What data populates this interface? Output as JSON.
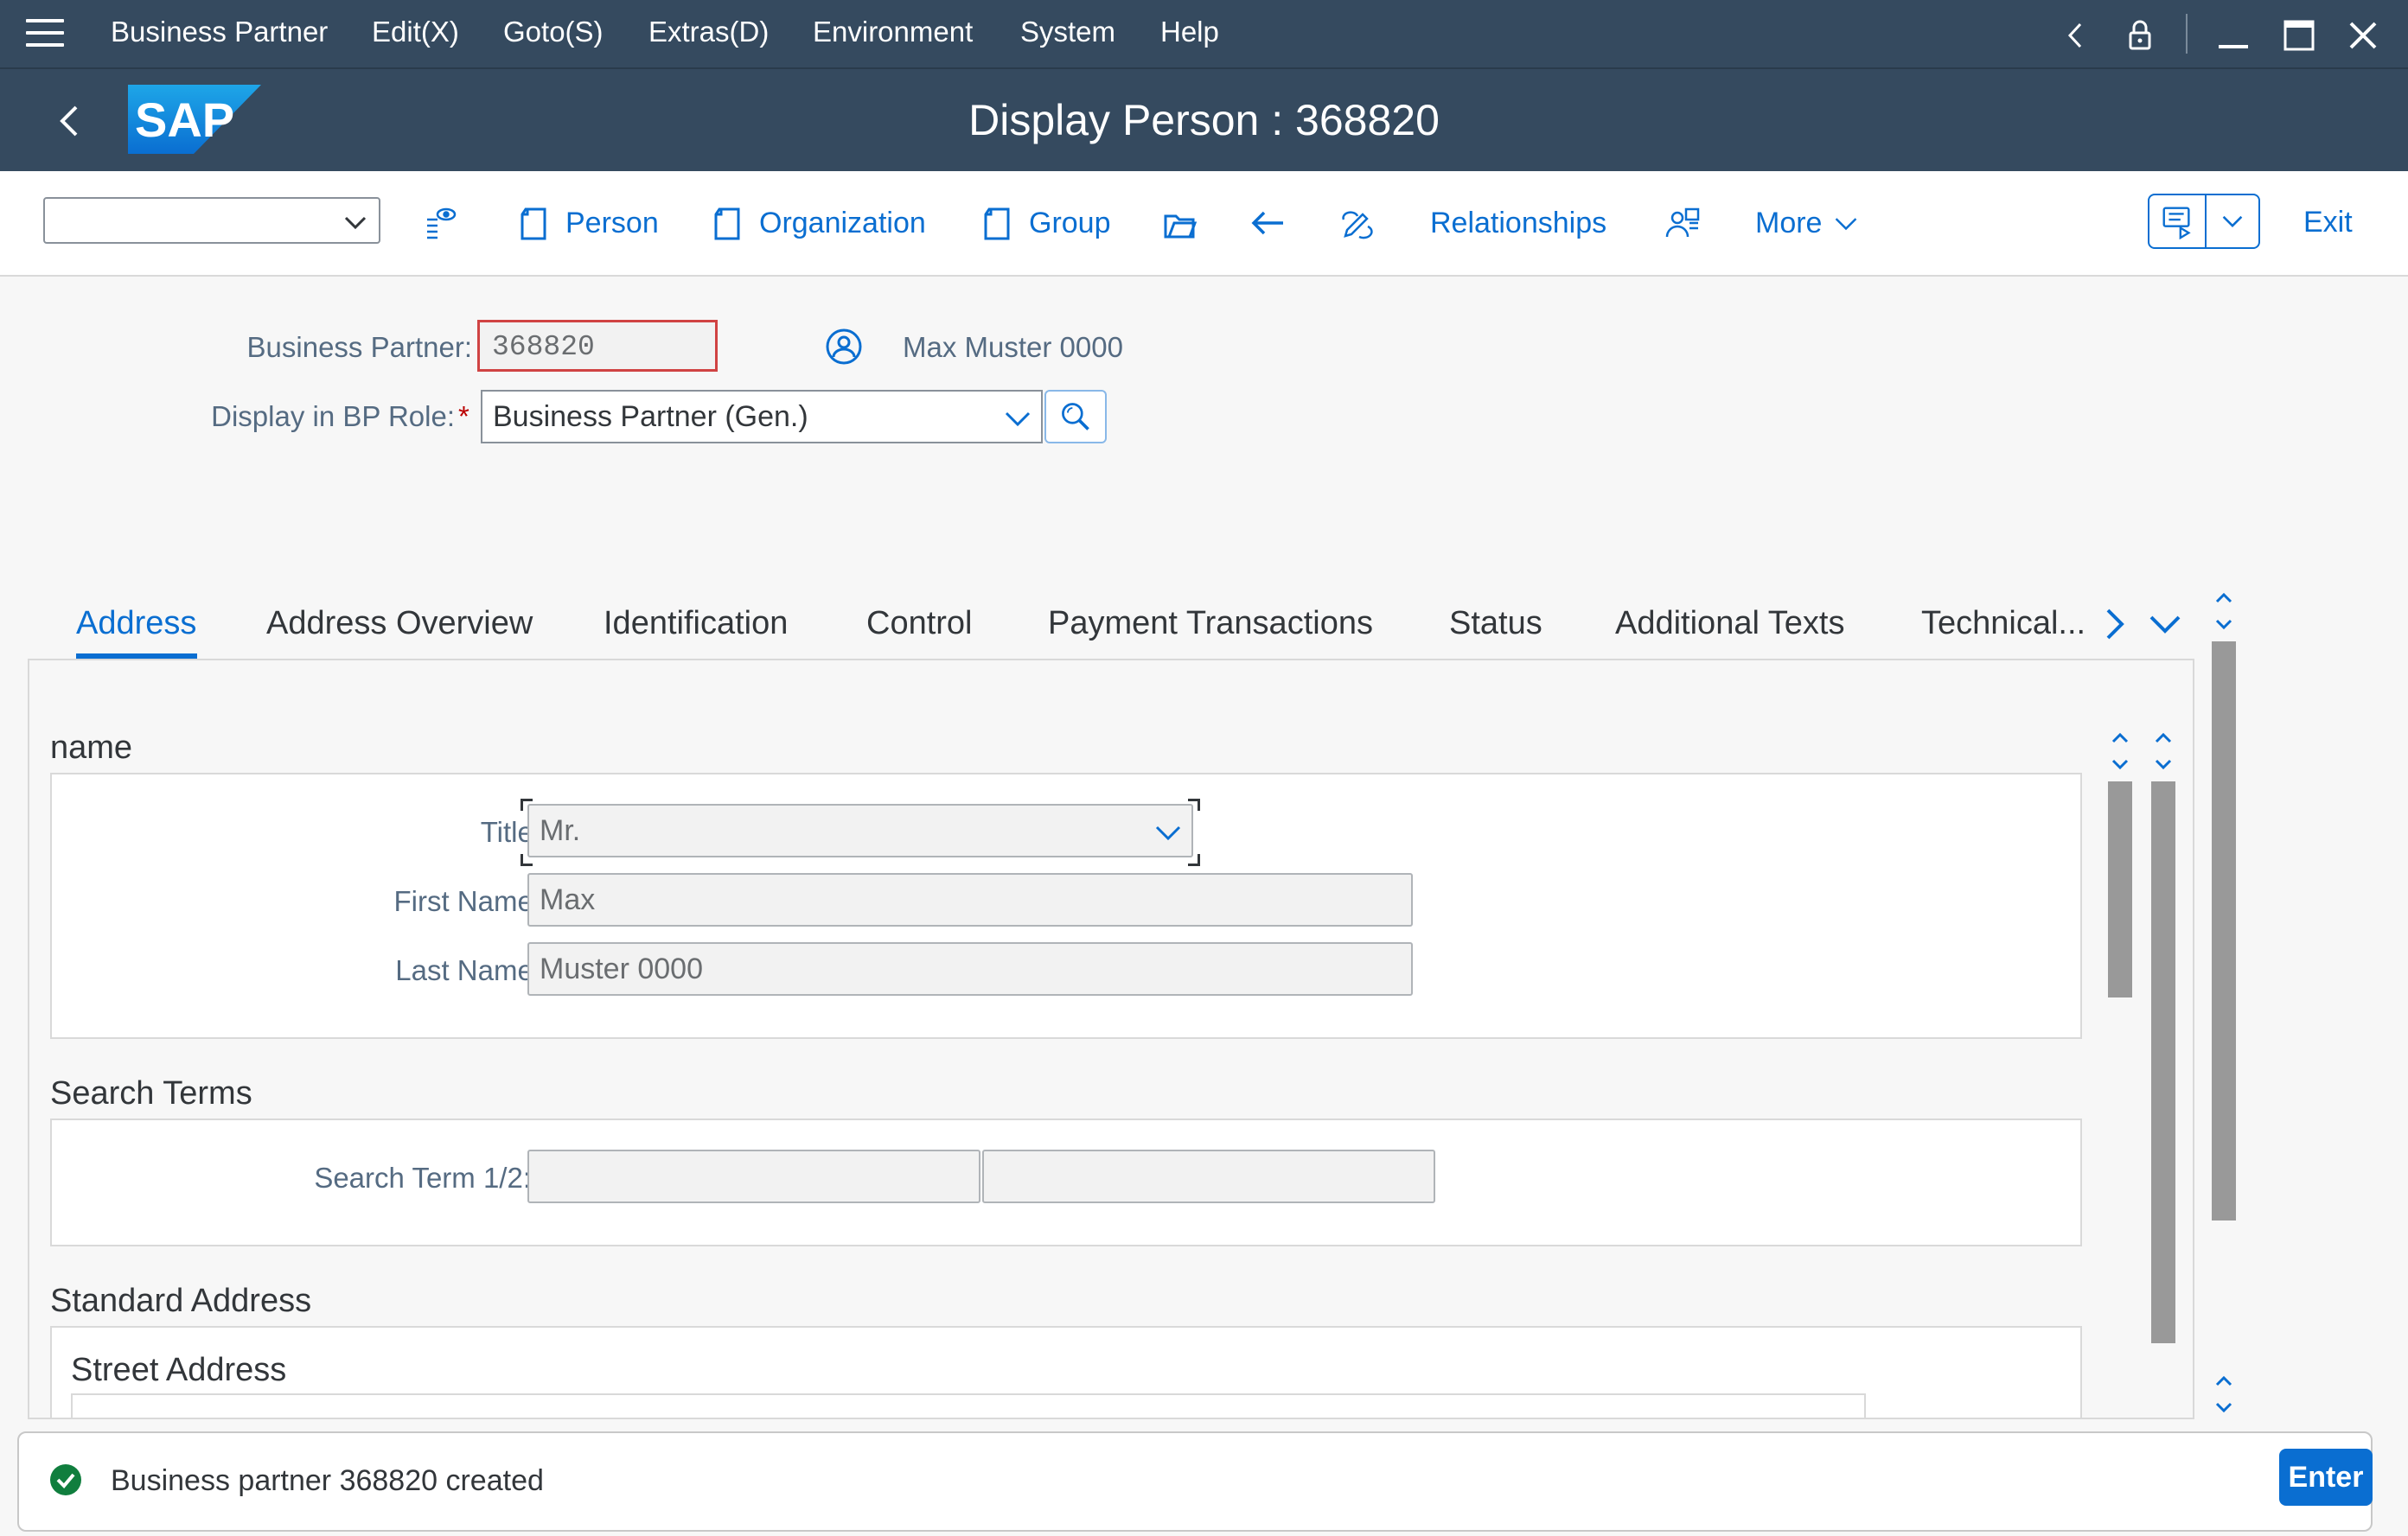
{
  "menubar": {
    "items": [
      "Business Partner",
      "Edit(X)",
      "Goto(S)",
      "Extras(D)",
      "Environment",
      "System",
      "Help"
    ]
  },
  "titlebar": {
    "title": "Display Person : 368820",
    "logo_text": "SAP"
  },
  "toolbar": {
    "select_value": "",
    "person": "Person",
    "organization": "Organization",
    "group": "Group",
    "relationships": "Relationships",
    "more": "More",
    "exit": "Exit"
  },
  "header": {
    "bp_label": "Business Partner:",
    "bp_value": "368820",
    "bp_name": "Max Muster 0000",
    "role_label": "Display in BP Role:",
    "role_required": "*",
    "role_value": "Business Partner (Gen.)"
  },
  "tabs": [
    "Address",
    "Address Overview",
    "Identification",
    "Control",
    "Payment Transactions",
    "Status",
    "Additional Texts",
    "Technical..."
  ],
  "active_tab": "Address",
  "name_group": {
    "title": "name",
    "title_label": "Title:",
    "title_value": "Mr.",
    "first_label": "First Name:",
    "first_value": "Max",
    "last_label": "Last Name:",
    "last_value": "Muster 0000"
  },
  "search_group": {
    "title": "Search Terms",
    "label": "Search Term 1/2:",
    "term1": "",
    "term2": ""
  },
  "address_group": {
    "title": "Standard Address",
    "street_title": "Street Address"
  },
  "status": {
    "message": "Business partner 368820 created",
    "enter_label": "Enter"
  },
  "colors": {
    "shell": "#354a5f",
    "accent": "#0a6ed1",
    "success": "#107e3e",
    "error": "#d04343"
  }
}
